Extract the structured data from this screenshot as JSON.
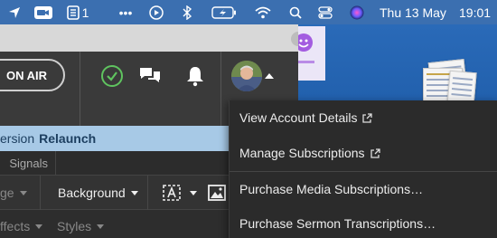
{
  "menubar": {
    "battery_icon": "battery-charging-icon",
    "notes_count": "1",
    "dots": "•••",
    "date": "Thu 13 May",
    "time": "19:01"
  },
  "app": {
    "on_air_label": "ON AIR",
    "banner_prefix": "ersion",
    "banner_action": "Relaunch",
    "tab_signals": "Signals",
    "format_left": "ge",
    "background_label": "Background",
    "effects_label": "ffects",
    "styles_label": "Styles"
  },
  "account_menu": {
    "items": [
      {
        "label": "View Account Details",
        "external": true
      },
      {
        "label": "Manage Subscriptions",
        "external": true
      },
      {
        "label": "Purchase Media Subscriptions…",
        "external": false
      },
      {
        "label": "Purchase Sermon Transcriptions…",
        "external": false
      }
    ]
  },
  "colors": {
    "menubar": "#3b6fb0",
    "banner": "#a7c9e6",
    "menu_bg": "#2b2b2b",
    "check_green": "#5fc35f"
  }
}
